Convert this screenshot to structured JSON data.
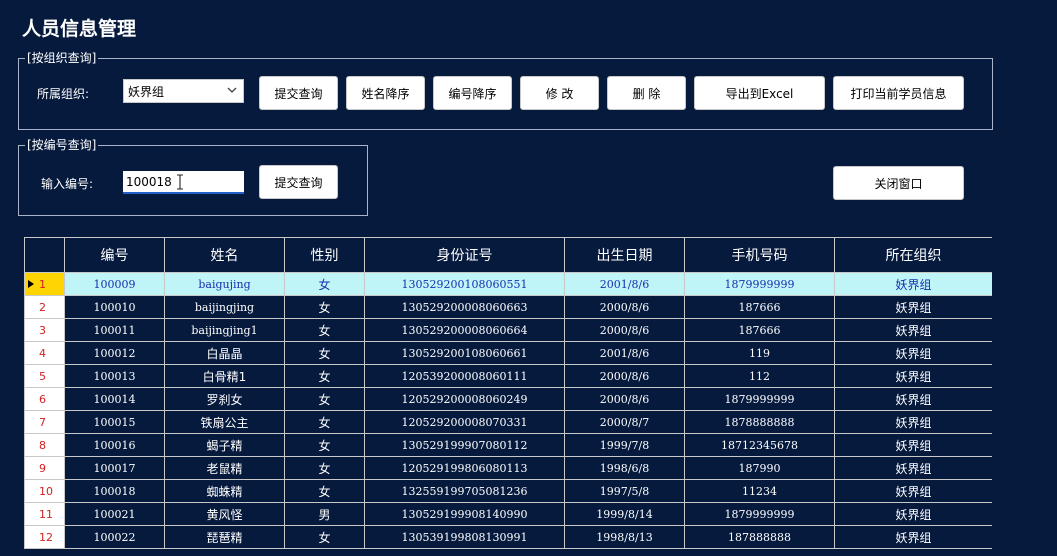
{
  "window": {
    "title": "人员信息管理"
  },
  "org_query": {
    "legend": "[按组织查询]",
    "org_label": "所属组织:",
    "org_selected": "妖界组",
    "buttons": {
      "submit": "提交查询",
      "sort_name": "姓名降序",
      "sort_id": "编号降序",
      "edit": "修 改",
      "delete": "删 除",
      "export": "导出到Excel",
      "print": "打印当前学员信息"
    }
  },
  "id_query": {
    "legend": "[按编号查询]",
    "id_label": "输入编号:",
    "id_value": "100018",
    "submit": "提交查询"
  },
  "close_button": "关闭窗口",
  "grid": {
    "columns": [
      "编号",
      "姓名",
      "性别",
      "身份证号",
      "出生日期",
      "手机号码",
      "所在组织"
    ],
    "rows": [
      {
        "n": "1",
        "id": "100009",
        "name": "baigujing",
        "gender": "女",
        "idcard": "130529200108060551",
        "birth": "2001/8/6",
        "phone": "1879999999",
        "org": "妖界组"
      },
      {
        "n": "2",
        "id": "100010",
        "name": "baijingjing",
        "gender": "女",
        "idcard": "130529200008060663",
        "birth": "2000/8/6",
        "phone": "187666",
        "org": "妖界组"
      },
      {
        "n": "3",
        "id": "100011",
        "name": "baijingjing1",
        "gender": "女",
        "idcard": "130529200008060664",
        "birth": "2000/8/6",
        "phone": "187666",
        "org": "妖界组"
      },
      {
        "n": "4",
        "id": "100012",
        "name": "白晶晶",
        "gender": "女",
        "idcard": "130529200108060661",
        "birth": "2001/8/6",
        "phone": "119",
        "org": "妖界组"
      },
      {
        "n": "5",
        "id": "100013",
        "name": "白骨精1",
        "gender": "女",
        "idcard": "120539200008060111",
        "birth": "2000/8/6",
        "phone": "112",
        "org": "妖界组"
      },
      {
        "n": "6",
        "id": "100014",
        "name": "罗刹女",
        "gender": "女",
        "idcard": "120529200008060249",
        "birth": "2000/8/6",
        "phone": "1879999999",
        "org": "妖界组"
      },
      {
        "n": "7",
        "id": "100015",
        "name": "铁扇公主",
        "gender": "女",
        "idcard": "120529200008070331",
        "birth": "2000/8/7",
        "phone": "1878888888",
        "org": "妖界组"
      },
      {
        "n": "8",
        "id": "100016",
        "name": "蝎子精",
        "gender": "女",
        "idcard": "130529199907080112",
        "birth": "1999/7/8",
        "phone": "18712345678",
        "org": "妖界组"
      },
      {
        "n": "9",
        "id": "100017",
        "name": "老鼠精",
        "gender": "女",
        "idcard": "120529199806080113",
        "birth": "1998/6/8",
        "phone": "187990",
        "org": "妖界组"
      },
      {
        "n": "10",
        "id": "100018",
        "name": "蜘蛛精",
        "gender": "女",
        "idcard": "132559199705081236",
        "birth": "1997/5/8",
        "phone": "11234",
        "org": "妖界组"
      },
      {
        "n": "11",
        "id": "100021",
        "name": "黄风怪",
        "gender": "男",
        "idcard": "130529199908140990",
        "birth": "1999/8/14",
        "phone": "1879999999",
        "org": "妖界组"
      },
      {
        "n": "12",
        "id": "100022",
        "name": "琵琶精",
        "gender": "女",
        "idcard": "130539199808130991",
        "birth": "1998/8/13",
        "phone": "187888888",
        "org": "妖界组"
      }
    ]
  },
  "colors": {
    "background": "#061a3e",
    "selected_row": "#bff5f7",
    "row_marker": "#ffd400",
    "row_number": "#d32020"
  },
  "icons": [
    "chevron-down-icon",
    "text-cursor-icon",
    "row-pointer-icon"
  ]
}
